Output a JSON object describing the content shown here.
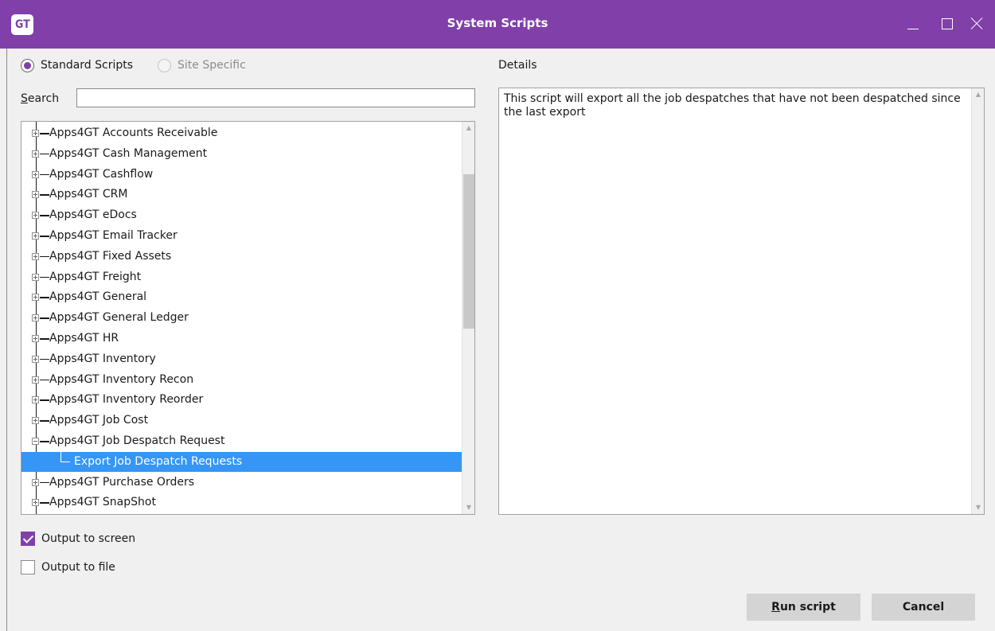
{
  "window": {
    "app_icon_text": "GT",
    "title": "System Scripts"
  },
  "script_source": {
    "options": [
      {
        "label": "Standard Scripts",
        "selected": true,
        "enabled": true
      },
      {
        "label": "Site Specific",
        "selected": false,
        "enabled": false
      }
    ]
  },
  "search": {
    "label_first": "S",
    "label_rest": "earch",
    "value": ""
  },
  "tree": {
    "items": [
      {
        "label": "Apps4GT Accounts Receivable",
        "expanded": false
      },
      {
        "label": "Apps4GT Cash Management",
        "expanded": false
      },
      {
        "label": "Apps4GT Cashflow",
        "expanded": false
      },
      {
        "label": "Apps4GT CRM",
        "expanded": false
      },
      {
        "label": "Apps4GT eDocs",
        "expanded": false
      },
      {
        "label": "Apps4GT Email Tracker",
        "expanded": false
      },
      {
        "label": "Apps4GT Fixed Assets",
        "expanded": false
      },
      {
        "label": "Apps4GT Freight",
        "expanded": false
      },
      {
        "label": "Apps4GT General",
        "expanded": false
      },
      {
        "label": "Apps4GT General Ledger",
        "expanded": false
      },
      {
        "label": "Apps4GT HR",
        "expanded": false
      },
      {
        "label": "Apps4GT Inventory",
        "expanded": false
      },
      {
        "label": "Apps4GT Inventory Recon",
        "expanded": false
      },
      {
        "label": "Apps4GT Inventory Reorder",
        "expanded": false
      },
      {
        "label": "Apps4GT Job Cost",
        "expanded": false
      },
      {
        "label": "Apps4GT Job Despatch Request",
        "expanded": true
      },
      {
        "label": "Export Job Despatch Requests",
        "child": true,
        "selected": true
      },
      {
        "label": "Apps4GT Purchase Orders",
        "expanded": false
      },
      {
        "label": "Apps4GT SnapShot",
        "expanded": false
      }
    ]
  },
  "details": {
    "label": "Details",
    "text": "This script will export all the job despatches that have not been despatched since the last export"
  },
  "output": {
    "screen": {
      "label": "Output to screen",
      "checked": true
    },
    "file": {
      "label": "Output to file",
      "checked": false
    }
  },
  "buttons": {
    "run_first": "R",
    "run_rest": "un script",
    "cancel": "Cancel"
  },
  "colors": {
    "accent": "#8140a9",
    "selection": "#3596f5"
  }
}
